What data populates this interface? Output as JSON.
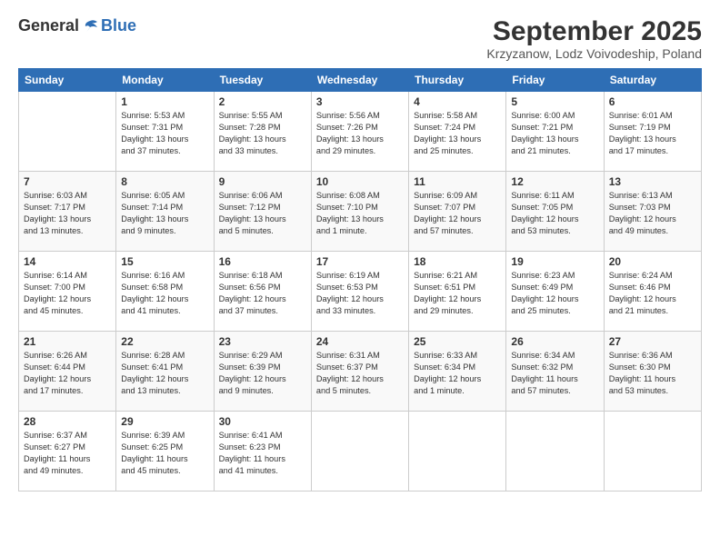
{
  "header": {
    "logo_general": "General",
    "logo_blue": "Blue",
    "month_title": "September 2025",
    "location": "Krzyzanow, Lodz Voivodeship, Poland"
  },
  "days_of_week": [
    "Sunday",
    "Monday",
    "Tuesday",
    "Wednesday",
    "Thursday",
    "Friday",
    "Saturday"
  ],
  "weeks": [
    [
      {
        "day": "",
        "info": ""
      },
      {
        "day": "1",
        "info": "Sunrise: 5:53 AM\nSunset: 7:31 PM\nDaylight: 13 hours\nand 37 minutes."
      },
      {
        "day": "2",
        "info": "Sunrise: 5:55 AM\nSunset: 7:28 PM\nDaylight: 13 hours\nand 33 minutes."
      },
      {
        "day": "3",
        "info": "Sunrise: 5:56 AM\nSunset: 7:26 PM\nDaylight: 13 hours\nand 29 minutes."
      },
      {
        "day": "4",
        "info": "Sunrise: 5:58 AM\nSunset: 7:24 PM\nDaylight: 13 hours\nand 25 minutes."
      },
      {
        "day": "5",
        "info": "Sunrise: 6:00 AM\nSunset: 7:21 PM\nDaylight: 13 hours\nand 21 minutes."
      },
      {
        "day": "6",
        "info": "Sunrise: 6:01 AM\nSunset: 7:19 PM\nDaylight: 13 hours\nand 17 minutes."
      }
    ],
    [
      {
        "day": "7",
        "info": "Sunrise: 6:03 AM\nSunset: 7:17 PM\nDaylight: 13 hours\nand 13 minutes."
      },
      {
        "day": "8",
        "info": "Sunrise: 6:05 AM\nSunset: 7:14 PM\nDaylight: 13 hours\nand 9 minutes."
      },
      {
        "day": "9",
        "info": "Sunrise: 6:06 AM\nSunset: 7:12 PM\nDaylight: 13 hours\nand 5 minutes."
      },
      {
        "day": "10",
        "info": "Sunrise: 6:08 AM\nSunset: 7:10 PM\nDaylight: 13 hours\nand 1 minute."
      },
      {
        "day": "11",
        "info": "Sunrise: 6:09 AM\nSunset: 7:07 PM\nDaylight: 12 hours\nand 57 minutes."
      },
      {
        "day": "12",
        "info": "Sunrise: 6:11 AM\nSunset: 7:05 PM\nDaylight: 12 hours\nand 53 minutes."
      },
      {
        "day": "13",
        "info": "Sunrise: 6:13 AM\nSunset: 7:03 PM\nDaylight: 12 hours\nand 49 minutes."
      }
    ],
    [
      {
        "day": "14",
        "info": "Sunrise: 6:14 AM\nSunset: 7:00 PM\nDaylight: 12 hours\nand 45 minutes."
      },
      {
        "day": "15",
        "info": "Sunrise: 6:16 AM\nSunset: 6:58 PM\nDaylight: 12 hours\nand 41 minutes."
      },
      {
        "day": "16",
        "info": "Sunrise: 6:18 AM\nSunset: 6:56 PM\nDaylight: 12 hours\nand 37 minutes."
      },
      {
        "day": "17",
        "info": "Sunrise: 6:19 AM\nSunset: 6:53 PM\nDaylight: 12 hours\nand 33 minutes."
      },
      {
        "day": "18",
        "info": "Sunrise: 6:21 AM\nSunset: 6:51 PM\nDaylight: 12 hours\nand 29 minutes."
      },
      {
        "day": "19",
        "info": "Sunrise: 6:23 AM\nSunset: 6:49 PM\nDaylight: 12 hours\nand 25 minutes."
      },
      {
        "day": "20",
        "info": "Sunrise: 6:24 AM\nSunset: 6:46 PM\nDaylight: 12 hours\nand 21 minutes."
      }
    ],
    [
      {
        "day": "21",
        "info": "Sunrise: 6:26 AM\nSunset: 6:44 PM\nDaylight: 12 hours\nand 17 minutes."
      },
      {
        "day": "22",
        "info": "Sunrise: 6:28 AM\nSunset: 6:41 PM\nDaylight: 12 hours\nand 13 minutes."
      },
      {
        "day": "23",
        "info": "Sunrise: 6:29 AM\nSunset: 6:39 PM\nDaylight: 12 hours\nand 9 minutes."
      },
      {
        "day": "24",
        "info": "Sunrise: 6:31 AM\nSunset: 6:37 PM\nDaylight: 12 hours\nand 5 minutes."
      },
      {
        "day": "25",
        "info": "Sunrise: 6:33 AM\nSunset: 6:34 PM\nDaylight: 12 hours\nand 1 minute."
      },
      {
        "day": "26",
        "info": "Sunrise: 6:34 AM\nSunset: 6:32 PM\nDaylight: 11 hours\nand 57 minutes."
      },
      {
        "day": "27",
        "info": "Sunrise: 6:36 AM\nSunset: 6:30 PM\nDaylight: 11 hours\nand 53 minutes."
      }
    ],
    [
      {
        "day": "28",
        "info": "Sunrise: 6:37 AM\nSunset: 6:27 PM\nDaylight: 11 hours\nand 49 minutes."
      },
      {
        "day": "29",
        "info": "Sunrise: 6:39 AM\nSunset: 6:25 PM\nDaylight: 11 hours\nand 45 minutes."
      },
      {
        "day": "30",
        "info": "Sunrise: 6:41 AM\nSunset: 6:23 PM\nDaylight: 11 hours\nand 41 minutes."
      },
      {
        "day": "",
        "info": ""
      },
      {
        "day": "",
        "info": ""
      },
      {
        "day": "",
        "info": ""
      },
      {
        "day": "",
        "info": ""
      }
    ]
  ]
}
